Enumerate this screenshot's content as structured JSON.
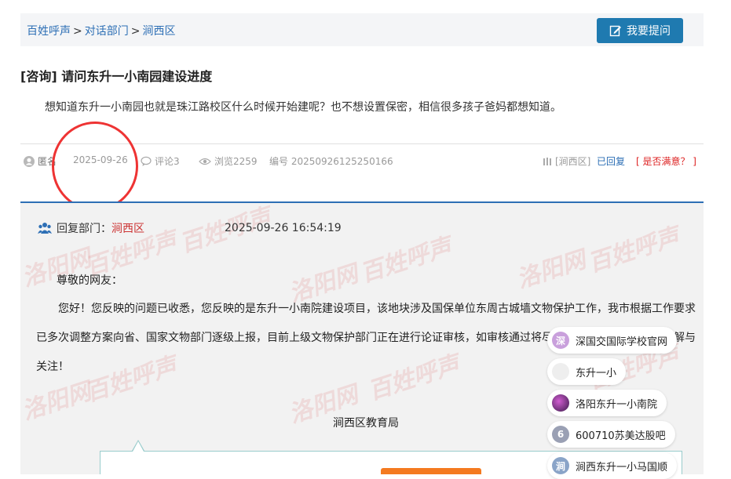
{
  "breadcrumb": {
    "items": [
      "百姓呼声",
      "对话部门",
      "涧西区"
    ],
    "separator": ">"
  },
  "ask_button": {
    "label": "我要提问"
  },
  "question": {
    "tag": "[咨询]",
    "title": "请问东升一小南园建设进度",
    "body": "想知道东升一小南园也就是珠江路校区什么时候开始建呢？也不想设置保密，相信很多孩子爸妈都想知道。"
  },
  "meta": {
    "author": "匿名",
    "date": "2025-09-26",
    "comments": "评论3",
    "views": "浏览2259",
    "number": "编号 20250926125250166",
    "district": "[涧西区]",
    "status": "已回复",
    "satisfaction": "[ 是否满意？ ]"
  },
  "reply": {
    "dept_label": "回复部门：",
    "dept_name": "涧西区",
    "time": "2025-09-26 16:54:19",
    "salutation": "尊敬的网友：",
    "body": "您好！您反映的问题已收悉，您反映的是东升一小南院建设项目，该地块涉及国保单位东周古城墙文物保护工作，我市根据工作要求已多次调整方案向省、国家文物部门逐级上报，目前上级文物保护部门正在进行论证审核，如审核通过将尽快开工建设。感谢您的理解与关注！",
    "signature": "涧西区教育局"
  },
  "watermark": {
    "text1": "洛阳网",
    "text2": "百姓呼声"
  },
  "suggestions": [
    {
      "avatar": "深",
      "label": "深国交国际学校官网",
      "color": "#c9a0dc"
    },
    {
      "avatar": "",
      "label": "东升一小",
      "color": "#eeeeee"
    },
    {
      "avatar": "",
      "label": "洛阳东升一小南院",
      "color": "#3a1a4a"
    },
    {
      "avatar": "6",
      "label": "600710苏美达股吧",
      "color": "#9aa0b4"
    },
    {
      "avatar": "涧",
      "label": "涧西东升一小马国顺",
      "color": "#8aa4c8"
    }
  ]
}
